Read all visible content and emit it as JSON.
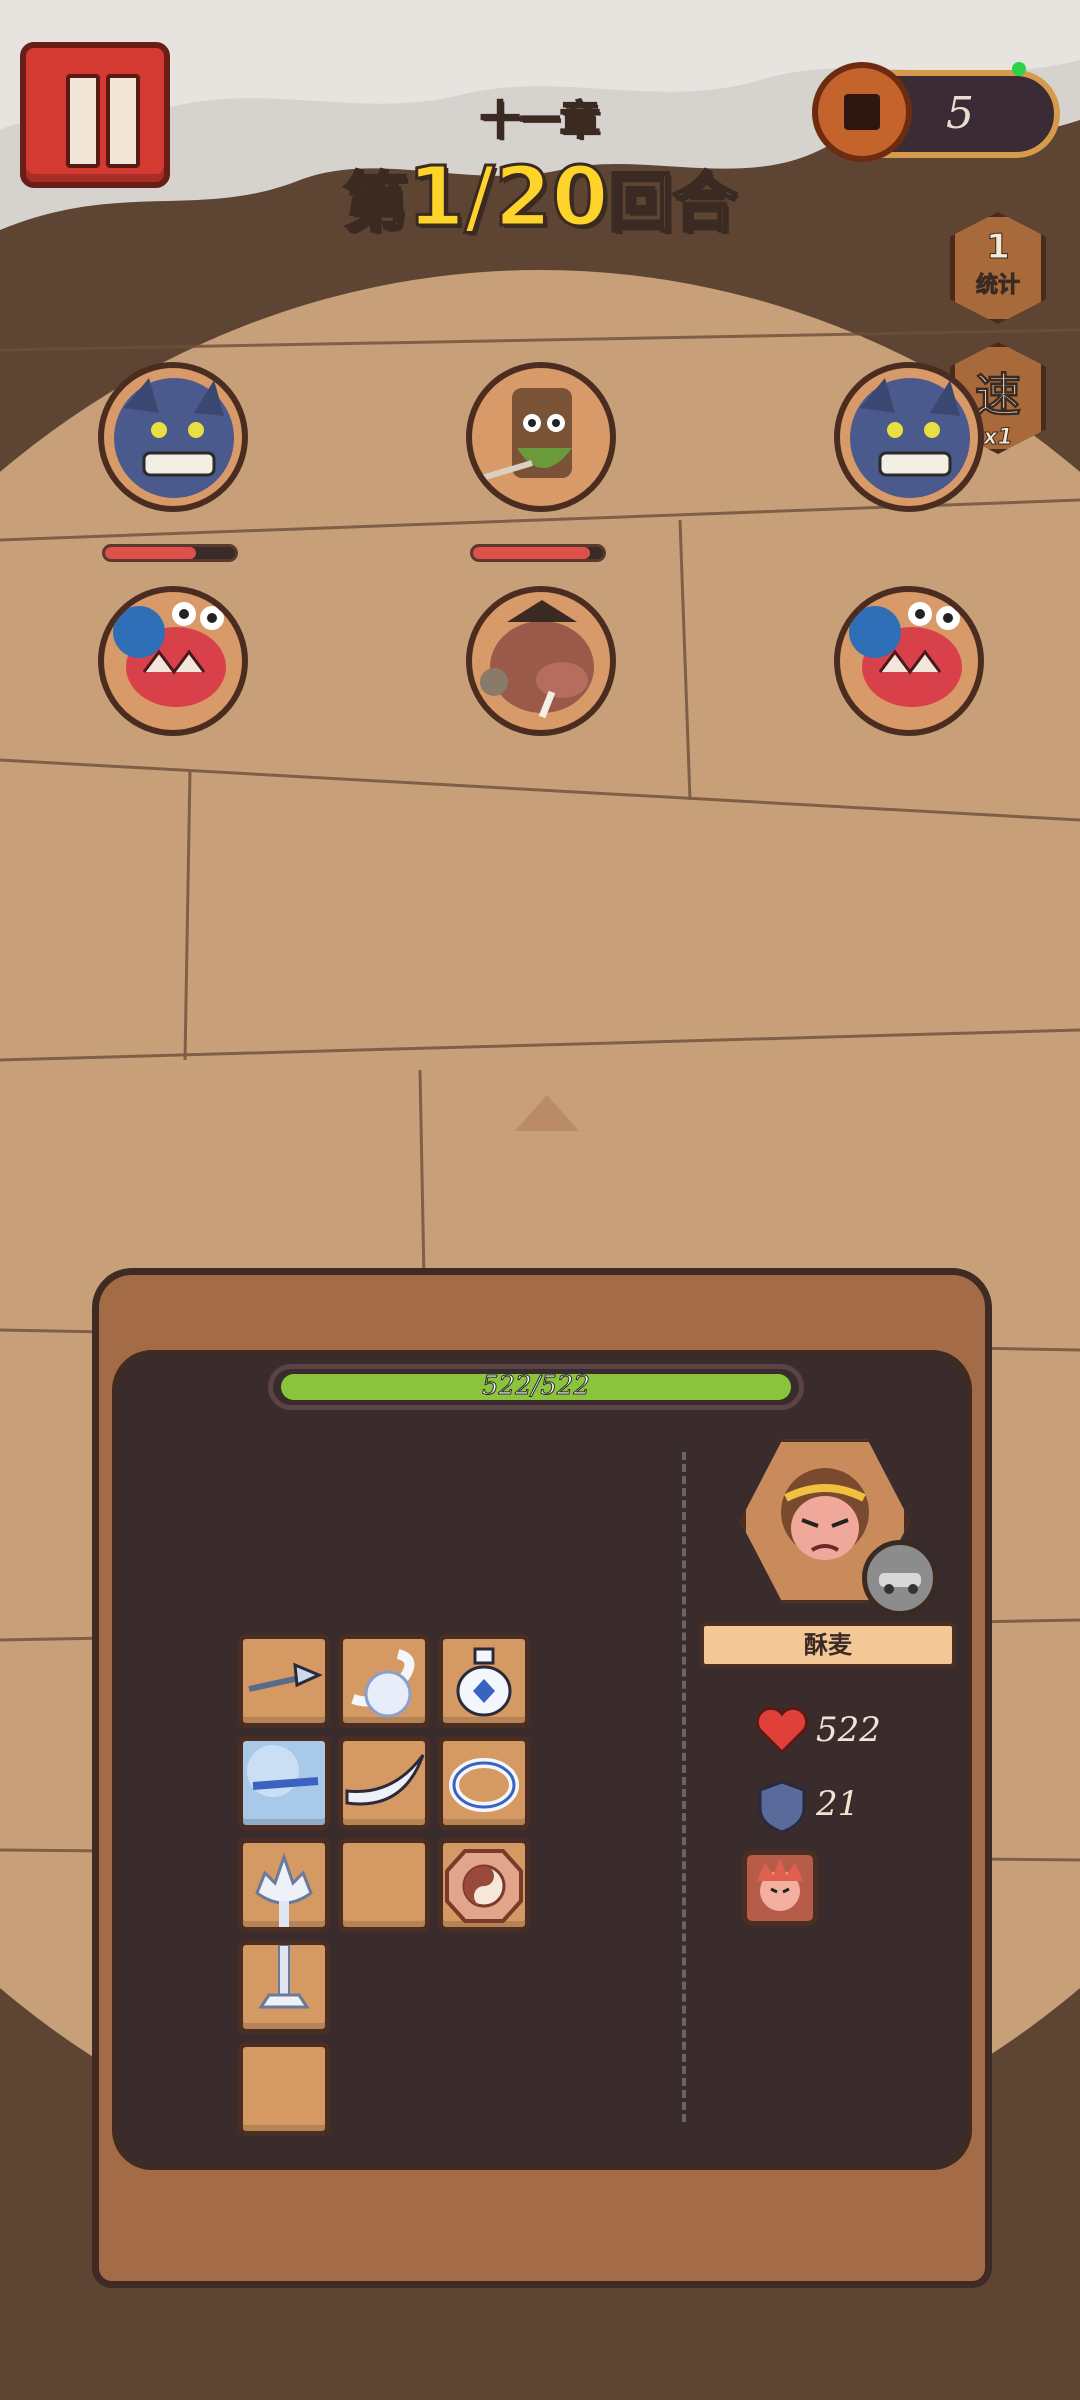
{
  "header": {
    "chapter": "十一章",
    "round_prefix": "第",
    "round_number": "1/20",
    "round_suffix": "回合",
    "coins": "5"
  },
  "side_buttons": {
    "stats_icon": "1",
    "stats_label": "统计",
    "speed_icon": "速",
    "speed_label": "x1"
  },
  "enemies": [
    {
      "name": "wolf-warrior",
      "hp": null
    },
    {
      "name": "treant-archer",
      "hp": null
    },
    {
      "name": "wolf-warrior",
      "hp": null
    },
    {
      "name": "crab-fighter",
      "hp_fraction": 0.7
    },
    {
      "name": "boar-brute",
      "hp_fraction": 0.9
    },
    {
      "name": "crab-fighter",
      "hp_fraction": null
    }
  ],
  "player": {
    "hp_text": "522/522",
    "hp_fraction": 1.0,
    "name": "酥麦",
    "health": "522",
    "armor": "21"
  },
  "inventory": [
    {
      "item": "trident-spear-icon"
    },
    {
      "item": "wind-gust-icon"
    },
    {
      "item": "gourd-potion-icon"
    },
    {
      "item": "ice-orb-icon"
    },
    {
      "item": "curved-blade-icon"
    },
    {
      "item": "jade-ring-icon"
    },
    {
      "item": "lotus-lamp-icon"
    },
    {
      "item": "empty"
    },
    {
      "item": "taiji-amulet-icon"
    },
    {
      "item": "lamp-stand-icon"
    },
    {
      "item": "empty"
    }
  ],
  "colors": {
    "hp_player": "#8bc43c",
    "hp_enemy": "#e0504a",
    "gold_text": "#ffd42a",
    "pause_red": "#d43a31"
  }
}
